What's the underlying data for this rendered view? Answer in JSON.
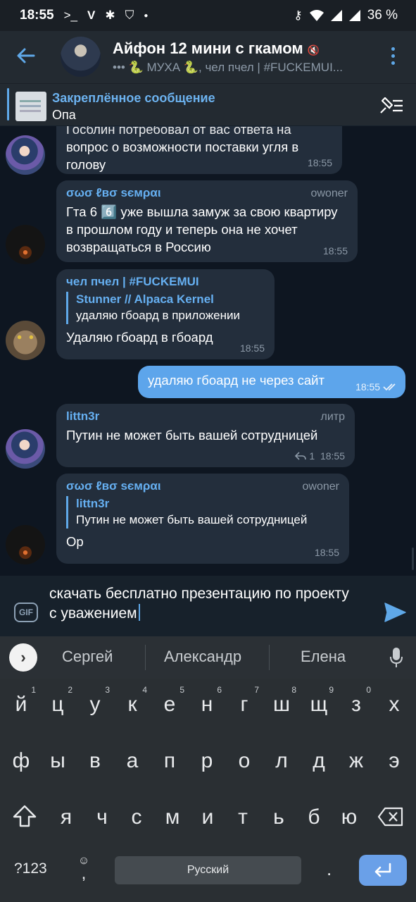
{
  "status_bar": {
    "time": "18:55",
    "battery": "36 %",
    "icons": [
      "terminal-icon",
      "v-icon",
      "bug-icon",
      "shield-icon",
      "dot-icon",
      "key-icon",
      "wifi-icon",
      "signal-icon",
      "signal-icon"
    ]
  },
  "header": {
    "title": "Айфон 12 мини с гкамом",
    "subtitle": "••• 🐍 МУХА 🐍, чел пчел | #FUCKEMUI..."
  },
  "pinned": {
    "title": "Закреплённое сообщение",
    "text": "Опа"
  },
  "messages": [
    {
      "text": "вопрос о возможности поставки угля в голову",
      "partial_top": "Госблин потребовал от вас ответа на",
      "time": "18:55"
    },
    {
      "sender": "σωσ ℓвσ ѕємραι",
      "role": "owoner",
      "text": "Гта 6 6️⃣ уже вышла замуж за свою квартиру в прошлом году и теперь она не хочет возвращаться в Россию",
      "time": "18:55"
    },
    {
      "sender": "чел пчел | #FUCKEMUI",
      "reply_name": "Stunner // Alpaca Kernel",
      "reply_text": "удаляю гбоард в приложении",
      "text": "Удаляю гбоард в гбоард",
      "time": "18:55"
    },
    {
      "outgoing": true,
      "text": "удаляю гбоард не через сайт",
      "time": "18:55"
    },
    {
      "sender": "littn3r",
      "role": "литр",
      "text": "Путин не может быть вашей сотрудницей",
      "reaction_count": "1",
      "time": "18:55"
    },
    {
      "sender": "σωσ ℓвσ ѕємραι",
      "role": "owoner",
      "reply_name": "littn3r",
      "reply_text": "Путин не может быть вашей сотрудницей",
      "text": "Ор",
      "time": "18:55"
    }
  ],
  "input": {
    "gif_label": "GIF",
    "text": "скачать бесплатно презентацию по проекту с уважением"
  },
  "suggestions": [
    "Сергей",
    "Александр",
    "Елена"
  ],
  "keyboard": {
    "row1": [
      "й",
      "ц",
      "у",
      "к",
      "е",
      "н",
      "г",
      "ш",
      "щ",
      "з",
      "х"
    ],
    "row1_hints": [
      "1",
      "2",
      "3",
      "4",
      "5",
      "6",
      "7",
      "8",
      "9",
      "0",
      ""
    ],
    "row2": [
      "ф",
      "ы",
      "в",
      "а",
      "п",
      "р",
      "о",
      "л",
      "д",
      "ж",
      "э"
    ],
    "row3": [
      "я",
      "ч",
      "с",
      "м",
      "и",
      "т",
      "ь",
      "б",
      "ю"
    ],
    "symbols_label": "?123",
    "comma": ",",
    "space_label": "Русский",
    "period": "."
  }
}
